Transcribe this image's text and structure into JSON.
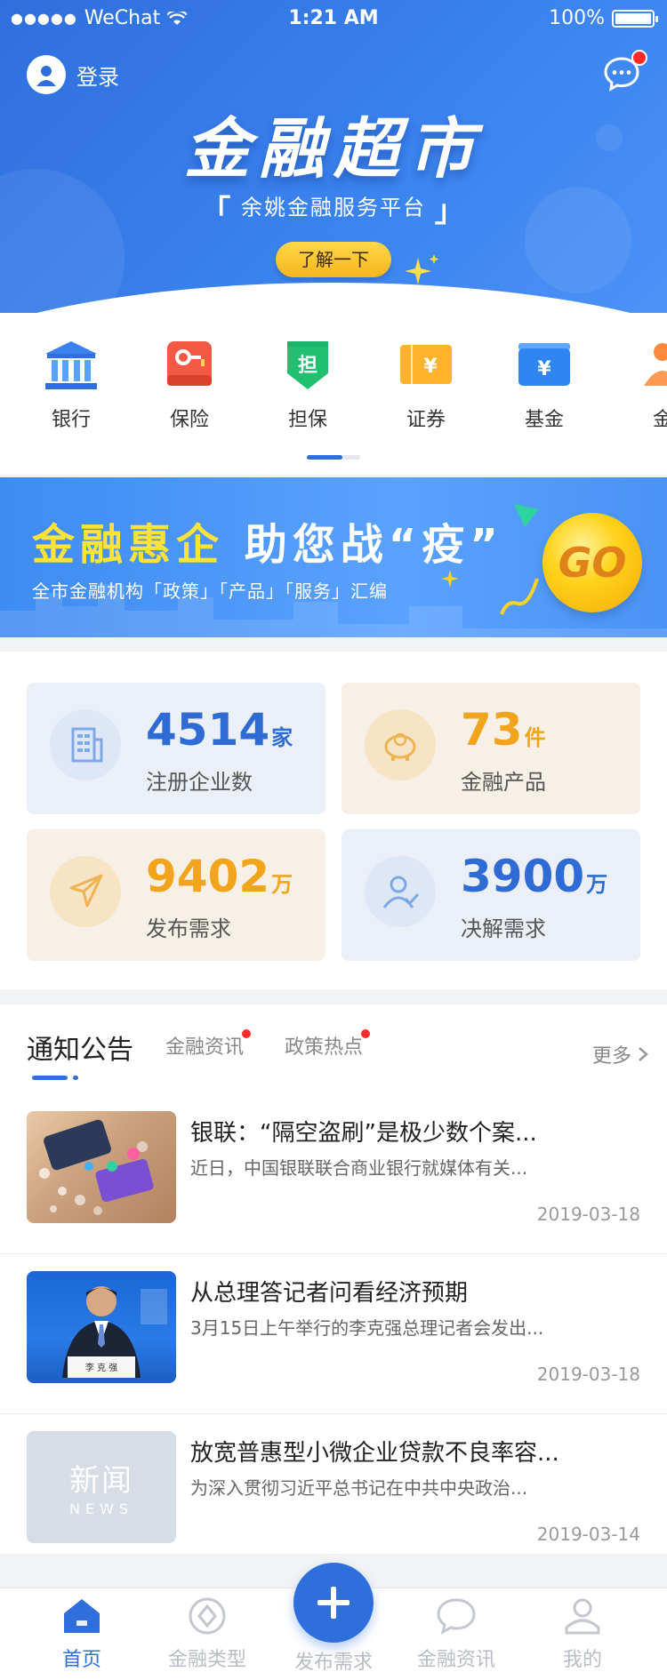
{
  "status_bar": {
    "carrier": "WeChat",
    "time": "1:21 AM",
    "battery": "100%"
  },
  "header": {
    "login_label": "登录",
    "title": "金融超市",
    "subtitle": "余姚金融服务平台",
    "learn_more": "了解一下"
  },
  "categories": [
    {
      "label": "银行",
      "icon": "bank-icon"
    },
    {
      "label": "保险",
      "icon": "insurance-icon"
    },
    {
      "label": "担保",
      "icon": "guarantee-icon"
    },
    {
      "label": "证券",
      "icon": "securities-icon"
    },
    {
      "label": "基金",
      "icon": "fund-icon"
    },
    {
      "label": "金",
      "icon": "finance-icon"
    }
  ],
  "banner": {
    "title_highlight": "金融惠企",
    "title_rest": "助您战“疫”",
    "subtitle": "全市金融机构「政策」「产品」「服务」汇编",
    "go": "GO"
  },
  "stats": [
    {
      "number": "4514",
      "unit": "家",
      "caption": "注册企业数",
      "theme": "blue",
      "icon": "building-icon"
    },
    {
      "number": "73",
      "unit": "件",
      "caption": "金融产品",
      "theme": "cream",
      "icon": "piggy-bank-icon"
    },
    {
      "number": "9402",
      "unit": "万",
      "caption": "发布需求",
      "theme": "cream",
      "icon": "send-icon"
    },
    {
      "number": "3900",
      "unit": "万",
      "caption": "决解需求",
      "theme": "blue",
      "icon": "user-check-icon"
    }
  ],
  "news": {
    "tabs": [
      {
        "label": "通知公告",
        "active": true,
        "dot": false
      },
      {
        "label": "金融资讯",
        "active": false,
        "dot": true
      },
      {
        "label": "政策热点",
        "active": false,
        "dot": true
      }
    ],
    "more": "更多",
    "items": [
      {
        "title": "银联：“隔空盗刷”是极少数个案...",
        "desc": "近日，中国银联联合商业银行就媒体有关...",
        "date": "2019-03-18"
      },
      {
        "title": "从总理答记者问看经济预期",
        "desc": "3月15日上午举行的李克强总理记者会发出...",
        "date": "2019-03-18"
      },
      {
        "title": "放宽普惠型小微企业贷款不良率容...",
        "desc": "为深入贯彻习近平总书记在中共中央政治...",
        "date": "2019-03-14",
        "placeholder_main": "新闻",
        "placeholder_sub": "NEWS"
      }
    ]
  },
  "tabbar": [
    {
      "label": "首页",
      "icon": "home-icon",
      "active": true
    },
    {
      "label": "金融类型",
      "icon": "category-icon",
      "active": false
    },
    {
      "label": "发布需求",
      "icon": "plus-icon",
      "active": false
    },
    {
      "label": "金融资讯",
      "icon": "chat-icon",
      "active": false
    },
    {
      "label": "我的",
      "icon": "profile-icon",
      "active": false
    }
  ],
  "colors": {
    "primary": "#2f6fdc",
    "accent_yellow": "#f1a41c",
    "badge_red": "#ff2b2b"
  }
}
